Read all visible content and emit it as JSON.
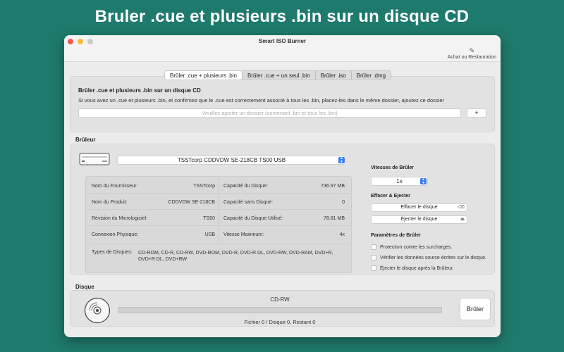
{
  "banner": {
    "title": "Bruler .cue et plusieurs .bin sur un disque CD"
  },
  "window": {
    "title": "Smart ISO Burner",
    "toolbar": {
      "restore_label": "Achat ou Restauration",
      "restore_icon": "pen-icon"
    }
  },
  "tabs": [
    {
      "label": "Brûler .cue + plusieurs .bin",
      "active": true
    },
    {
      "label": "Brûler .cue + un seul .bin",
      "active": false
    },
    {
      "label": "Brûler .iso",
      "active": false
    },
    {
      "label": "Brûler .dmg",
      "active": false
    }
  ],
  "source": {
    "heading": "Brûler .cue et plusieurs .bin sur un disque CD",
    "description": "Si vous avez un .cue et plusieurs .bin, et confirmez que le .cue est correctement associé à tous les .bin, placez-les dans le même dossier, ajoutez ce dossier",
    "folder_placeholder": "Veuillez ajouter un dossier (contenant .bin et tous les .bin)",
    "add_label": "+"
  },
  "burner": {
    "section_label": "Brûleur",
    "drive": "TSSTcorp CDDVDW SE-218CB TS00 USB",
    "info_left": [
      {
        "label": "Nom du Fournisseur:",
        "value": "TSSTcorp"
      },
      {
        "label": "Nom du Produit:",
        "value": "CDDVDW SE-218CB"
      },
      {
        "label": "Révision du Micrologiciel:",
        "value": "TS00"
      },
      {
        "label": "Connexion Physique:",
        "value": "USB"
      }
    ],
    "info_right": [
      {
        "label": "Capacité du Disque:",
        "value": "736.97 MB"
      },
      {
        "label": "Capacité sans Disque:",
        "value": "0"
      },
      {
        "label": "Capacité du Disque Utilisé:",
        "value": "78.81 MB"
      },
      {
        "label": "Vitesse Maximum:",
        "value": "4x"
      }
    ],
    "types_label": "Types de Disques:",
    "types_value": "CD-ROM, CD-R, CD-RW, DVD-ROM, DVD-R, DVD-R DL, DVD-RW, DVD-RAM, DVD+R, DVD+R DL, DVD+RW",
    "speed_label": "Vitesses de Brûler",
    "speed_value": "1x",
    "erase_section": "Effacer & Ejecter",
    "erase_button": "Effacer le disque",
    "eject_button": "Éjecter le disque",
    "params_label": "Paramètres de Brûler",
    "options": [
      {
        "label": "Protection contre les surcharges.",
        "checked": false
      },
      {
        "label": "Vérifier les données source écrites sur le disque.",
        "checked": false
      },
      {
        "label": "Éjecter le disque après la Brûleur.",
        "checked": false
      }
    ]
  },
  "disk": {
    "section_label": "Disque",
    "media": "CD-RW",
    "progress": 0,
    "status": "Fichier 0 / Disque 0, Restant 0",
    "burn_label": "Brûler"
  },
  "colors": {
    "background": "#1e7a6c",
    "accent": "#3b7cf0"
  }
}
